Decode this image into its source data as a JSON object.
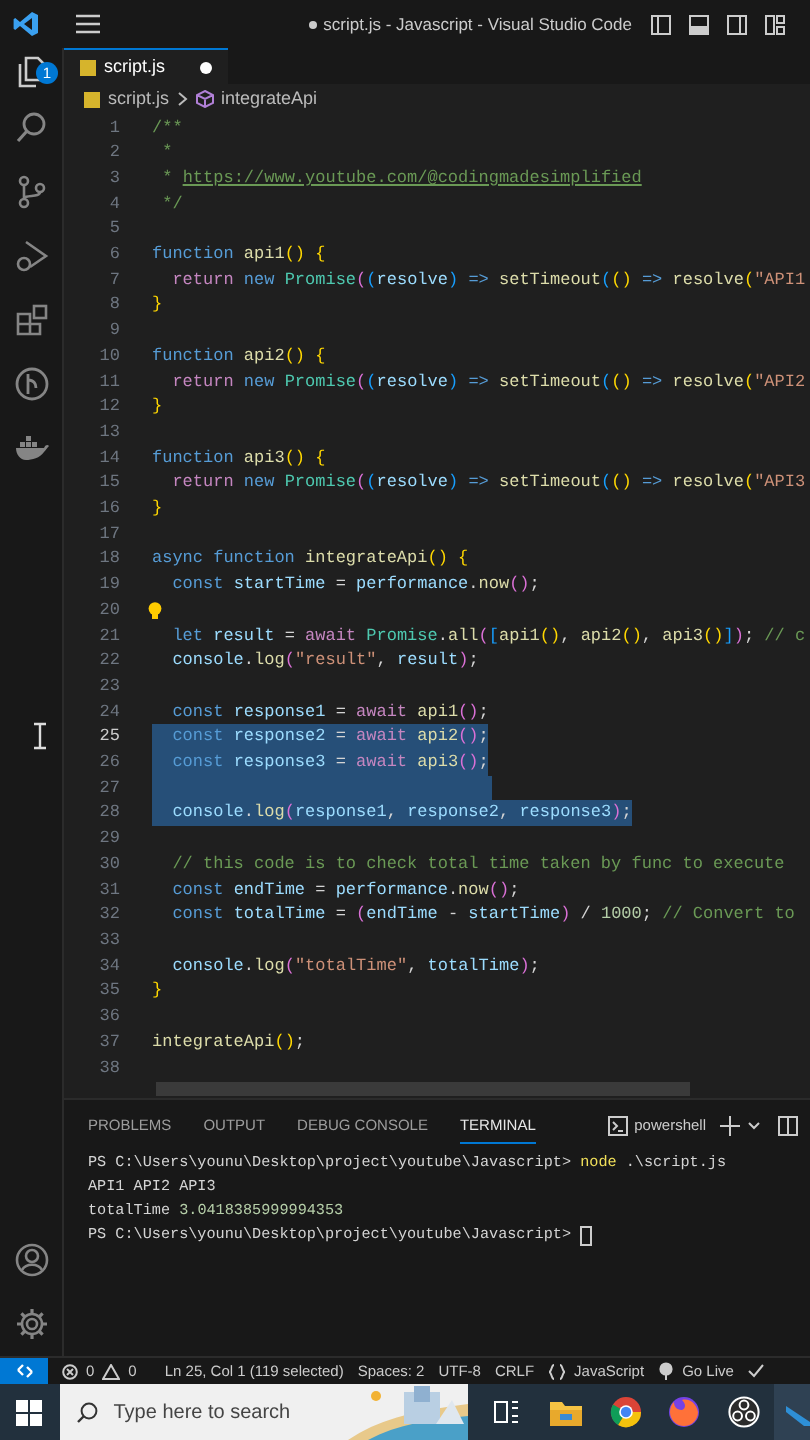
{
  "title_bar": {
    "title": "script.js - Javascript - Visual Studio Code",
    "modified": true
  },
  "activity_bar": {
    "explorer_badge": "1"
  },
  "tab": {
    "label": "script.js",
    "modified": true
  },
  "breadcrumb": [
    "script.js",
    "integrateApi"
  ],
  "editor": {
    "lines": [
      {
        "number": "1",
        "current": false,
        "selected": false,
        "lightbulb": false,
        "tokens": [
          {
            "kind": "comment",
            "text": "/**"
          }
        ]
      },
      {
        "number": "2",
        "current": false,
        "selected": false,
        "lightbulb": false,
        "tokens": [
          {
            "kind": "comment",
            "text": " *"
          }
        ]
      },
      {
        "number": "3",
        "current": false,
        "selected": false,
        "lightbulb": false,
        "tokens": [
          {
            "kind": "comment",
            "text": " * "
          },
          {
            "kind": "link",
            "text": "https://www.youtube.com/@codingmadesimplified"
          }
        ]
      },
      {
        "number": "4",
        "current": false,
        "selected": false,
        "lightbulb": false,
        "tokens": [
          {
            "kind": "comment",
            "text": " */"
          }
        ]
      },
      {
        "number": "5",
        "current": false,
        "selected": false,
        "lightbulb": false
      },
      {
        "number": "6",
        "current": false,
        "selected": false,
        "lightbulb": false,
        "tokens": [
          {
            "kind": "keyword",
            "text": "function "
          },
          {
            "kind": "function",
            "text": "api1"
          },
          {
            "kind": "bracket1",
            "text": "() {"
          }
        ]
      },
      {
        "number": "7",
        "current": false,
        "selected": false,
        "lightbulb": false,
        "tokens": [
          {
            "kind": "control",
            "text": "  return "
          },
          {
            "kind": "keyword",
            "text": "new "
          },
          {
            "kind": "class",
            "text": "Promise"
          },
          {
            "kind": "bracket2",
            "text": "("
          },
          {
            "kind": "bracket3",
            "text": "("
          },
          {
            "kind": "variable",
            "text": "resolve"
          },
          {
            "kind": "bracket3",
            "text": ") "
          },
          {
            "kind": "keyword",
            "text": "=> "
          },
          {
            "kind": "function",
            "text": "setTimeout"
          },
          {
            "kind": "bracket3",
            "text": "("
          },
          {
            "kind": "bracket1",
            "text": "() "
          },
          {
            "kind": "keyword",
            "text": "=> "
          },
          {
            "kind": "function",
            "text": "resolve"
          },
          {
            "kind": "bracket1",
            "text": "("
          },
          {
            "kind": "string",
            "text": "\"API1"
          }
        ]
      },
      {
        "number": "8",
        "current": false,
        "selected": false,
        "lightbulb": false,
        "tokens": [
          {
            "kind": "bracket1",
            "text": "}"
          }
        ]
      },
      {
        "number": "9",
        "current": false,
        "selected": false,
        "lightbulb": false
      },
      {
        "number": "10",
        "current": false,
        "selected": false,
        "lightbulb": false,
        "tokens": [
          {
            "kind": "keyword",
            "text": "function "
          },
          {
            "kind": "function",
            "text": "api2"
          },
          {
            "kind": "bracket1",
            "text": "() {"
          }
        ]
      },
      {
        "number": "11",
        "current": false,
        "selected": false,
        "lightbulb": false,
        "tokens": [
          {
            "kind": "control",
            "text": "  return "
          },
          {
            "kind": "keyword",
            "text": "new "
          },
          {
            "kind": "class",
            "text": "Promise"
          },
          {
            "kind": "bracket2",
            "text": "("
          },
          {
            "kind": "bracket3",
            "text": "("
          },
          {
            "kind": "variable",
            "text": "resolve"
          },
          {
            "kind": "bracket3",
            "text": ") "
          },
          {
            "kind": "keyword",
            "text": "=> "
          },
          {
            "kind": "function",
            "text": "setTimeout"
          },
          {
            "kind": "bracket3",
            "text": "("
          },
          {
            "kind": "bracket1",
            "text": "() "
          },
          {
            "kind": "keyword",
            "text": "=> "
          },
          {
            "kind": "function",
            "text": "resolve"
          },
          {
            "kind": "bracket1",
            "text": "("
          },
          {
            "kind": "string",
            "text": "\"API2"
          }
        ]
      },
      {
        "number": "12",
        "current": false,
        "selected": false,
        "lightbulb": false,
        "tokens": [
          {
            "kind": "bracket1",
            "text": "}"
          }
        ]
      },
      {
        "number": "13",
        "current": false,
        "selected": false,
        "lightbulb": false
      },
      {
        "number": "14",
        "current": false,
        "selected": false,
        "lightbulb": false,
        "tokens": [
          {
            "kind": "keyword",
            "text": "function "
          },
          {
            "kind": "function",
            "text": "api3"
          },
          {
            "kind": "bracket1",
            "text": "() {"
          }
        ]
      },
      {
        "number": "15",
        "current": false,
        "selected": false,
        "lightbulb": false,
        "tokens": [
          {
            "kind": "control",
            "text": "  return "
          },
          {
            "kind": "keyword",
            "text": "new "
          },
          {
            "kind": "class",
            "text": "Promise"
          },
          {
            "kind": "bracket2",
            "text": "("
          },
          {
            "kind": "bracket3",
            "text": "("
          },
          {
            "kind": "variable",
            "text": "resolve"
          },
          {
            "kind": "bracket3",
            "text": ") "
          },
          {
            "kind": "keyword",
            "text": "=> "
          },
          {
            "kind": "function",
            "text": "setTimeout"
          },
          {
            "kind": "bracket3",
            "text": "("
          },
          {
            "kind": "bracket1",
            "text": "() "
          },
          {
            "kind": "keyword",
            "text": "=> "
          },
          {
            "kind": "function",
            "text": "resolve"
          },
          {
            "kind": "bracket1",
            "text": "("
          },
          {
            "kind": "string",
            "text": "\"API3"
          }
        ]
      },
      {
        "number": "16",
        "current": false,
        "selected": false,
        "lightbulb": false,
        "tokens": [
          {
            "kind": "bracket1",
            "text": "}"
          }
        ]
      },
      {
        "number": "17",
        "current": false,
        "selected": false,
        "lightbulb": false
      },
      {
        "number": "18",
        "current": false,
        "selected": false,
        "lightbulb": false,
        "tokens": [
          {
            "kind": "keyword",
            "text": "async function "
          },
          {
            "kind": "function",
            "text": "integrateApi"
          },
          {
            "kind": "bracket1",
            "text": "() {"
          }
        ]
      },
      {
        "number": "19",
        "current": false,
        "selected": false,
        "lightbulb": false,
        "tokens": [
          {
            "kind": "keyword",
            "text": "  const "
          },
          {
            "kind": "variable",
            "text": "startTime "
          },
          {
            "kind": "punct",
            "text": "= "
          },
          {
            "kind": "variable",
            "text": "performance"
          },
          {
            "kind": "punct",
            "text": "."
          },
          {
            "kind": "function",
            "text": "now"
          },
          {
            "kind": "bracket2",
            "text": "()"
          },
          {
            "kind": "punct",
            "text": ";"
          }
        ]
      },
      {
        "number": "20",
        "current": false,
        "selected": false,
        "lightbulb": true
      },
      {
        "number": "21",
        "current": false,
        "selected": false,
        "lightbulb": false,
        "tokens": [
          {
            "kind": "keyword",
            "text": "  let "
          },
          {
            "kind": "variable",
            "text": "result "
          },
          {
            "kind": "punct",
            "text": "= "
          },
          {
            "kind": "control",
            "text": "await "
          },
          {
            "kind": "class",
            "text": "Promise"
          },
          {
            "kind": "punct",
            "text": "."
          },
          {
            "kind": "function",
            "text": "all"
          },
          {
            "kind": "bracket2",
            "text": "("
          },
          {
            "kind": "bracket3",
            "text": "["
          },
          {
            "kind": "function",
            "text": "api1"
          },
          {
            "kind": "bracket1",
            "text": "()"
          },
          {
            "kind": "punct",
            "text": ", "
          },
          {
            "kind": "function",
            "text": "api2"
          },
          {
            "kind": "bracket1",
            "text": "()"
          },
          {
            "kind": "punct",
            "text": ", "
          },
          {
            "kind": "function",
            "text": "api3"
          },
          {
            "kind": "bracket1",
            "text": "()"
          },
          {
            "kind": "bracket3",
            "text": "]"
          },
          {
            "kind": "bracket2",
            "text": ")"
          },
          {
            "kind": "punct",
            "text": "; "
          },
          {
            "kind": "comment",
            "text": "// c"
          }
        ]
      },
      {
        "number": "22",
        "current": false,
        "selected": false,
        "lightbulb": false,
        "tokens": [
          {
            "kind": "variable",
            "text": "  console"
          },
          {
            "kind": "punct",
            "text": "."
          },
          {
            "kind": "function",
            "text": "log"
          },
          {
            "kind": "bracket2",
            "text": "("
          },
          {
            "kind": "string",
            "text": "\"result\""
          },
          {
            "kind": "punct",
            "text": ", "
          },
          {
            "kind": "variable",
            "text": "result"
          },
          {
            "kind": "bracket2",
            "text": ")"
          },
          {
            "kind": "punct",
            "text": ";"
          }
        ]
      },
      {
        "number": "23",
        "current": false,
        "selected": false,
        "lightbulb": false
      },
      {
        "number": "24",
        "current": false,
        "selected": false,
        "lightbulb": false,
        "tokens": [
          {
            "kind": "keyword",
            "text": "  const "
          },
          {
            "kind": "variable",
            "text": "response1 "
          },
          {
            "kind": "punct",
            "text": "= "
          },
          {
            "kind": "control",
            "text": "await "
          },
          {
            "kind": "function",
            "text": "api1"
          },
          {
            "kind": "bracket2",
            "text": "()"
          },
          {
            "kind": "punct",
            "text": ";"
          }
        ]
      },
      {
        "number": "25",
        "current": true,
        "selected": true,
        "lightbulb": false,
        "tokens": [
          {
            "kind": "keyword",
            "text": "  const "
          },
          {
            "kind": "variable",
            "text": "response2 "
          },
          {
            "kind": "punct",
            "text": "= "
          },
          {
            "kind": "control",
            "text": "await "
          },
          {
            "kind": "function",
            "text": "api2"
          },
          {
            "kind": "bracket2",
            "text": "()"
          },
          {
            "kind": "punct",
            "text": ";"
          }
        ]
      },
      {
        "number": "26",
        "current": false,
        "selected": true,
        "lightbulb": false,
        "tokens": [
          {
            "kind": "keyword",
            "text": "  const "
          },
          {
            "kind": "variable",
            "text": "response3 "
          },
          {
            "kind": "punct",
            "text": "= "
          },
          {
            "kind": "control",
            "text": "await "
          },
          {
            "kind": "function",
            "text": "api3"
          },
          {
            "kind": "bracket2",
            "text": "()"
          },
          {
            "kind": "punct",
            "text": ";"
          }
        ]
      },
      {
        "number": "27",
        "current": false,
        "selected": true,
        "lightbulb": false
      },
      {
        "number": "28",
        "current": false,
        "selected": true,
        "lightbulb": false,
        "tokens": [
          {
            "kind": "variable",
            "text": "  console"
          },
          {
            "kind": "punct",
            "text": "."
          },
          {
            "kind": "function",
            "text": "log"
          },
          {
            "kind": "bracket2",
            "text": "("
          },
          {
            "kind": "variable",
            "text": "response1"
          },
          {
            "kind": "punct",
            "text": ", "
          },
          {
            "kind": "variable",
            "text": "response2"
          },
          {
            "kind": "punct",
            "text": ", "
          },
          {
            "kind": "variable",
            "text": "response3"
          },
          {
            "kind": "bracket2",
            "text": ")"
          },
          {
            "kind": "punct",
            "text": ";"
          }
        ]
      },
      {
        "number": "29",
        "current": false,
        "selected": false,
        "lightbulb": false
      },
      {
        "number": "30",
        "current": false,
        "selected": false,
        "lightbulb": false,
        "tokens": [
          {
            "kind": "comment",
            "text": "  // this code is to check total time taken by func to execute"
          }
        ]
      },
      {
        "number": "31",
        "current": false,
        "selected": false,
        "lightbulb": false,
        "tokens": [
          {
            "kind": "keyword",
            "text": "  const "
          },
          {
            "kind": "variable",
            "text": "endTime "
          },
          {
            "kind": "punct",
            "text": "= "
          },
          {
            "kind": "variable",
            "text": "performance"
          },
          {
            "kind": "punct",
            "text": "."
          },
          {
            "kind": "function",
            "text": "now"
          },
          {
            "kind": "bracket2",
            "text": "()"
          },
          {
            "kind": "punct",
            "text": ";"
          }
        ]
      },
      {
        "number": "32",
        "current": false,
        "selected": false,
        "lightbulb": false,
        "tokens": [
          {
            "kind": "keyword",
            "text": "  const "
          },
          {
            "kind": "variable",
            "text": "totalTime "
          },
          {
            "kind": "punct",
            "text": "= "
          },
          {
            "kind": "bracket2",
            "text": "("
          },
          {
            "kind": "variable",
            "text": "endTime "
          },
          {
            "kind": "punct",
            "text": "- "
          },
          {
            "kind": "variable",
            "text": "startTime"
          },
          {
            "kind": "bracket2",
            "text": ") "
          },
          {
            "kind": "punct",
            "text": "/ "
          },
          {
            "kind": "number",
            "text": "1000"
          },
          {
            "kind": "punct",
            "text": "; "
          },
          {
            "kind": "comment",
            "text": "// Convert to"
          }
        ]
      },
      {
        "number": "33",
        "current": false,
        "selected": false,
        "lightbulb": false
      },
      {
        "number": "34",
        "current": false,
        "selected": false,
        "lightbulb": false,
        "tokens": [
          {
            "kind": "variable",
            "text": "  console"
          },
          {
            "kind": "punct",
            "text": "."
          },
          {
            "kind": "function",
            "text": "log"
          },
          {
            "kind": "bracket2",
            "text": "("
          },
          {
            "kind": "string",
            "text": "\"totalTime\""
          },
          {
            "kind": "punct",
            "text": ", "
          },
          {
            "kind": "variable",
            "text": "totalTime"
          },
          {
            "kind": "bracket2",
            "text": ")"
          },
          {
            "kind": "punct",
            "text": ";"
          }
        ]
      },
      {
        "number": "35",
        "current": false,
        "selected": false,
        "lightbulb": false,
        "tokens": [
          {
            "kind": "bracket1",
            "text": "}"
          }
        ]
      },
      {
        "number": "36",
        "current": false,
        "selected": false,
        "lightbulb": false
      },
      {
        "number": "37",
        "current": false,
        "selected": false,
        "lightbulb": false,
        "tokens": [
          {
            "kind": "function",
            "text": "integrateApi"
          },
          {
            "kind": "bracket1",
            "text": "()"
          },
          {
            "kind": "punct",
            "text": ";"
          }
        ]
      },
      {
        "number": "38",
        "current": false,
        "selected": false,
        "lightbulb": false
      }
    ]
  },
  "panel": {
    "tabs": [
      {
        "label": "PROBLEMS",
        "selected": false
      },
      {
        "label": "OUTPUT",
        "selected": false
      },
      {
        "label": "DEBUG CONSOLE",
        "selected": false
      },
      {
        "label": "TERMINAL",
        "selected": true
      }
    ],
    "terminal_name": "powershell",
    "terminal": [
      {
        "cursor": false,
        "tokens": [
          {
            "kind": "punct",
            "text": "PS C:\\Users\\younu\\Desktop\\project\\youtube\\Javascript> "
          },
          {
            "kind": "command",
            "text": "node"
          },
          {
            "kind": "punct",
            "text": " .\\script.js"
          }
        ]
      },
      {
        "cursor": false,
        "tokens": [
          {
            "kind": "punct",
            "text": "API1 API2 API3"
          }
        ]
      },
      {
        "cursor": false,
        "tokens": [
          {
            "kind": "punct",
            "text": "totalTime "
          },
          {
            "kind": "number",
            "text": "3.0418385999994353"
          }
        ]
      },
      {
        "cursor": true,
        "tokens": [
          {
            "kind": "punct",
            "text": "PS C:\\Users\\younu\\Desktop\\project\\youtube\\Javascript> "
          }
        ]
      }
    ]
  },
  "status_bar": {
    "errors": "0",
    "warnings": "0",
    "position": "Ln 25, Col 1 (119 selected)",
    "indent": "Spaces: 2",
    "encoding": "UTF-8",
    "eol": "CRLF",
    "language": "JavaScript",
    "live": "Go Live"
  },
  "taskbar": {
    "search_placeholder": "Type here to search"
  }
}
